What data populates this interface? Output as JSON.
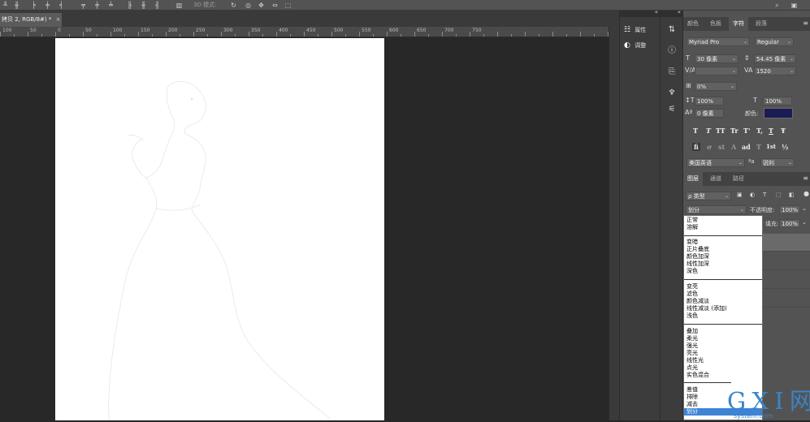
{
  "option_bar": {
    "mode_3d": "3D 模式:"
  },
  "document": {
    "tab_title": "拷贝 2, RGB/8#) *",
    "close": "×"
  },
  "ruler": {
    "labels": [
      "100",
      "50",
      "0",
      "50",
      "100",
      "150",
      "200",
      "250",
      "300",
      "350",
      "400",
      "450",
      "500",
      "550",
      "600",
      "650",
      "700",
      "750"
    ]
  },
  "dock": {
    "properties": "属性",
    "adjustments": "调整"
  },
  "character_panel": {
    "tabs": [
      "颜色",
      "色板",
      "字符",
      "段落"
    ],
    "font_family": "Myriad Pro",
    "font_style": "Regular",
    "font_size": "30 像素",
    "leading": "54.45 像素",
    "kerning": "",
    "tracking": "1520",
    "scale_percent": "0%",
    "vertical_scale": "100%",
    "horizontal_scale": "100%",
    "baseline_shift": "0 像素",
    "color_label": "颜色:",
    "color": "#1b1b55",
    "style_buttons": [
      "T",
      "T",
      "TT",
      "Tr",
      "T'",
      "T,",
      "T",
      "Ŧ"
    ],
    "opentype_buttons": [
      "fi",
      "ơ",
      "st",
      "A",
      "ad",
      "T",
      "1st",
      "½"
    ],
    "language": "美国英语",
    "aa_icon": "ªa",
    "antialias": "锐利"
  },
  "layers_panel": {
    "tabs": [
      "图层",
      "通道",
      "路径"
    ],
    "filter": "ρ 类型",
    "blend_mode": "划分",
    "opacity_label": "不透明度:",
    "opacity": "100%",
    "fill_label": "填充:",
    "fill": "100%"
  },
  "blend_menu": {
    "groups": [
      [
        "正常",
        "溶解"
      ],
      [
        "变暗",
        "正片叠底",
        "颜色加深",
        "线性加深",
        "深色"
      ],
      [
        "变亮",
        "滤色",
        "颜色减淡",
        "线性减淡 (添加)",
        "浅色"
      ],
      [
        "叠加",
        "柔光",
        "强光",
        "亮光",
        "线性光",
        "点光",
        "实色混合"
      ],
      [
        "差值",
        "排除",
        "减去",
        "划分"
      ]
    ],
    "selected": "划分"
  },
  "watermark": {
    "big": "G X I 网",
    "small": "system.com"
  }
}
